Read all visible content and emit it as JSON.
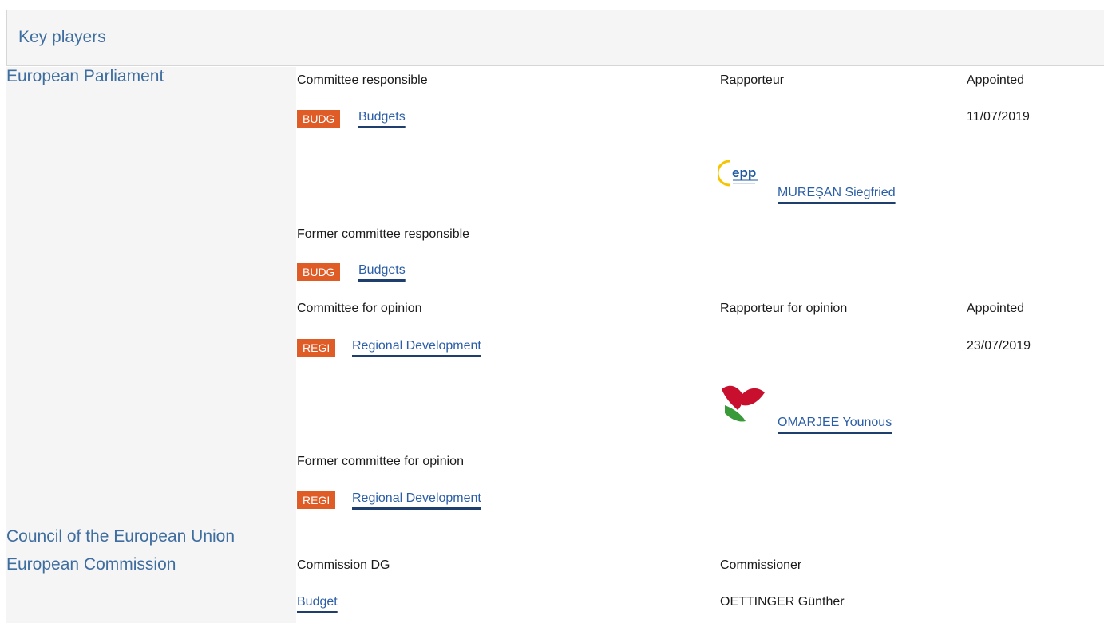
{
  "section_title": "Key players",
  "institutions": {
    "ep": "European Parliament",
    "council": "Council of the European Union",
    "commission": "European Commission"
  },
  "ep": {
    "committee_responsible": {
      "label": "Committee responsible",
      "rapporteur_label": "Rapporteur",
      "appointed_label": "Appointed",
      "badge": "BUDG",
      "committee": "Budgets",
      "appointed_date": "11/07/2019",
      "rapporteur_name": "MUREȘAN Siegfried",
      "group_logo": "epp-logo"
    },
    "former_committee_responsible": {
      "label": "Former committee responsible",
      "badge": "BUDG",
      "committee": "Budgets"
    },
    "committee_opinion": {
      "label": "Committee for opinion",
      "rapporteur_label": "Rapporteur for opinion",
      "appointed_label": "Appointed",
      "badge": "REGI",
      "committee": "Regional Development",
      "appointed_date": "23/07/2019",
      "rapporteur_name": "OMARJEE Younous",
      "group_logo": "gue-ngl-logo"
    },
    "former_committee_opinion": {
      "label": "Former committee for opinion",
      "badge": "REGI",
      "committee": "Regional Development"
    }
  },
  "commission": {
    "dg_label": "Commission DG",
    "commissioner_label": "Commissioner",
    "dg": "Budget",
    "commissioner": "OETTINGER Günther"
  },
  "colors": {
    "heading": "#3e6d9f",
    "badge": "#e05c27",
    "link": "#2b5ea6",
    "panel": "#f5f5f5"
  }
}
